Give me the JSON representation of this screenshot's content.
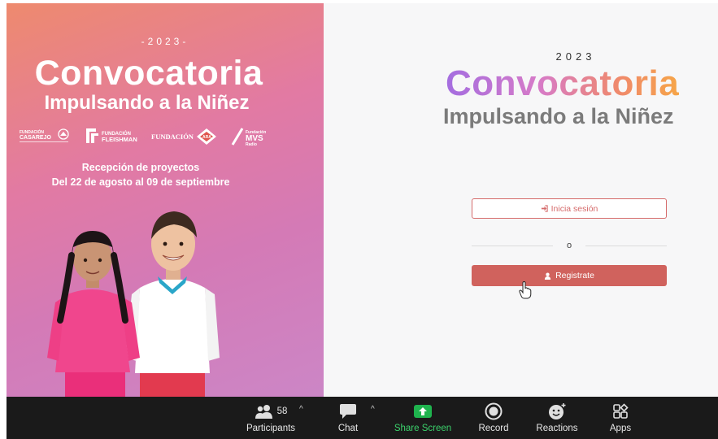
{
  "promo": {
    "year": "-2023-",
    "title": "Convocatoria",
    "subtitle": "Impulsando a la Niñez",
    "logos": [
      {
        "name": "FUNDACIÓN CASAREJO"
      },
      {
        "name": "FUNDACIÓN FLEISHMAN"
      },
      {
        "name": "FUNDACIÓN"
      },
      {
        "name": "MVS Radio"
      }
    ],
    "reception_line1": "Recepción de proyectos",
    "reception_line2": "Del 22 de agosto al 09 de septiembre"
  },
  "login": {
    "year": "2023",
    "title": "Convocatoria",
    "subtitle": "Impulsando a la Niñez",
    "login_button": "Inicia sesión",
    "divider_text": "o",
    "register_button": "Registrate",
    "colors": {
      "accent": "#d0625d",
      "title_gradient_start": "#a46de0",
      "title_gradient_end": "#f6a548"
    }
  },
  "toolbar": {
    "participants_label": "Participants",
    "participants_count": "58",
    "chat_label": "Chat",
    "share_label": "Share Screen",
    "record_label": "Record",
    "reactions_label": "Reactions",
    "apps_label": "Apps",
    "colors": {
      "background": "#1a1a1a",
      "share": "#3bd16b"
    }
  }
}
